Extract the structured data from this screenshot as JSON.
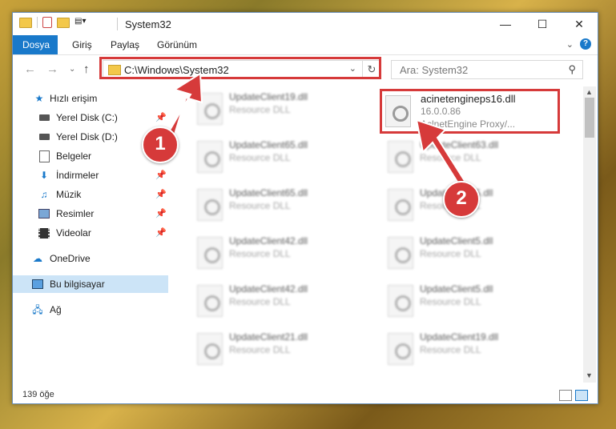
{
  "window": {
    "title": "System32"
  },
  "ribbon": {
    "tabs": [
      {
        "label": "Dosya",
        "active": true
      },
      {
        "label": "Giriş"
      },
      {
        "label": "Paylaş"
      },
      {
        "label": "Görünüm"
      }
    ]
  },
  "address": {
    "path": "C:\\Windows\\System32"
  },
  "search": {
    "placeholder": "Ara: System32"
  },
  "sidebar": {
    "items": [
      {
        "label": "Hızlı erişim",
        "icon": "star-icon"
      },
      {
        "label": "Yerel Disk (C:)",
        "icon": "drive-icon",
        "pinned": true
      },
      {
        "label": "Yerel Disk (D:)",
        "icon": "drive-icon"
      },
      {
        "label": "Belgeler",
        "icon": "documents-icon",
        "pinned": true
      },
      {
        "label": "İndirmeler",
        "icon": "download-icon",
        "pinned": true
      },
      {
        "label": "Müzik",
        "icon": "music-icon",
        "pinned": true
      },
      {
        "label": "Resimler",
        "icon": "pictures-icon",
        "pinned": true
      },
      {
        "label": "Videolar",
        "icon": "videos-icon",
        "pinned": true
      },
      {
        "label": "OneDrive",
        "icon": "cloud-icon"
      },
      {
        "label": "Bu bilgisayar",
        "icon": "computer-icon",
        "selected": true
      },
      {
        "label": "Ağ",
        "icon": "network-icon"
      }
    ]
  },
  "files": {
    "left": [
      {
        "name": "UpdateClient19.dll",
        "desc": "Resource DLL"
      },
      {
        "name": "UpdateClient65.dll",
        "desc": "Resource DLL"
      },
      {
        "name": "UpdateClient65.dll",
        "desc": "Resource DLL"
      },
      {
        "name": "UpdateClient42.dll",
        "desc": "Resource DLL"
      },
      {
        "name": "UpdateClient42.dll",
        "desc": "Resource DLL"
      },
      {
        "name": "UpdateClient21.dll",
        "desc": "Resource DLL"
      }
    ],
    "right": [
      {
        "name": "UpdateClient63.dll",
        "desc": "Resource DLL"
      },
      {
        "name": "UpdateClient5.dll",
        "desc": "Resource DLL"
      },
      {
        "name": "UpdateClient5.dll",
        "desc": "Resource DLL"
      },
      {
        "name": "UpdateClient5.dll",
        "desc": "Resource DLL"
      },
      {
        "name": "UpdateClient19.dll",
        "desc": "Resource DLL"
      }
    ],
    "selected": {
      "name": "acinetengineps16.dll",
      "version": "16.0.0.86",
      "desc": "AclnetEngine Proxy/..."
    }
  },
  "status": {
    "count": "139 öğe"
  },
  "callouts": [
    "1",
    "2"
  ],
  "colors": {
    "accent": "#1979ca",
    "highlight": "#d63a3a"
  }
}
